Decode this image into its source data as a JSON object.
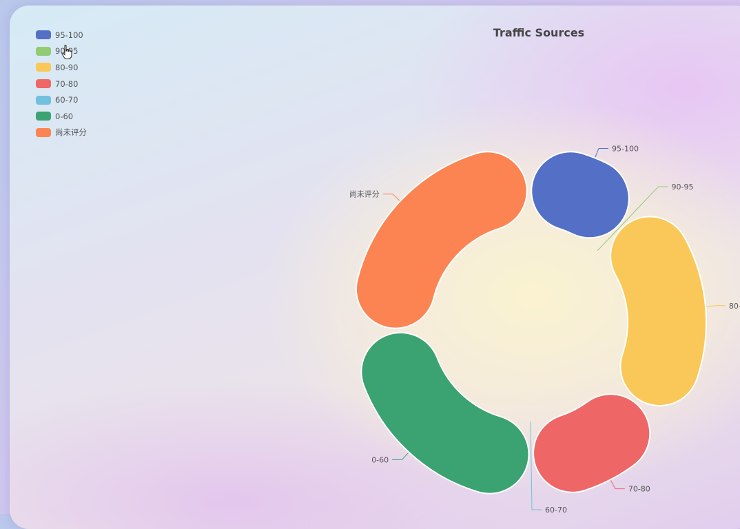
{
  "chart_data": {
    "type": "pie",
    "subtype": "rose-donut",
    "title": "Traffic Sources",
    "legend_position": "top-left",
    "series": [
      {
        "name": "95-100",
        "value": 52,
        "color": "#5470c6"
      },
      {
        "name": "90-95",
        "value": 0,
        "color": "#91cc75"
      },
      {
        "name": "80-90",
        "value": 102,
        "color": "#fac858"
      },
      {
        "name": "70-80",
        "value": 64,
        "color": "#ee6666"
      },
      {
        "name": "60-70",
        "value": 0,
        "color": "#73c0de"
      },
      {
        "name": "0-60",
        "value": 108,
        "color": "#3ba272"
      },
      {
        "name": "尚未评分",
        "value": 116,
        "color": "#fc8452"
      }
    ]
  }
}
